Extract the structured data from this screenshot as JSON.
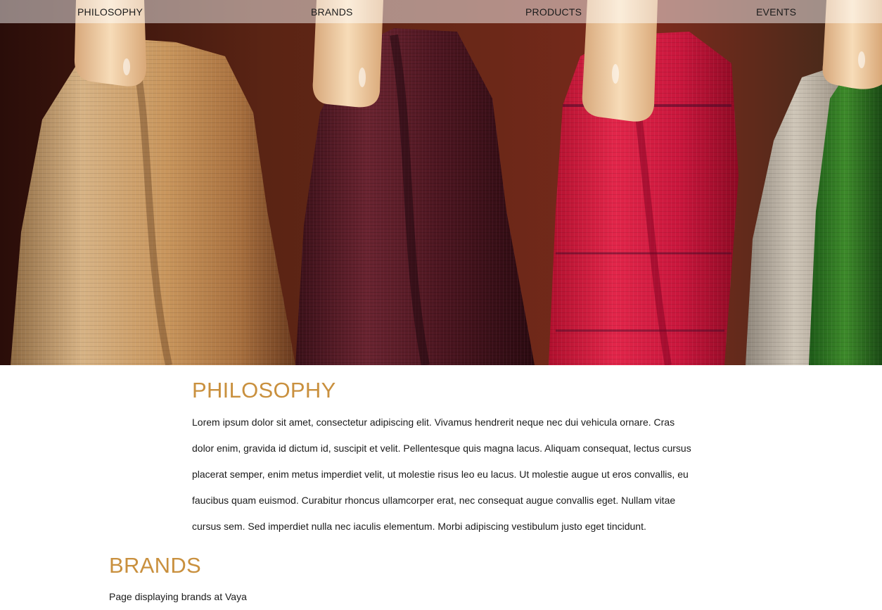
{
  "nav": {
    "items": [
      {
        "label": "PHILOSOPHY"
      },
      {
        "label": "BRANDS"
      },
      {
        "label": "PRODUCTS"
      },
      {
        "label": "EVENTS"
      }
    ]
  },
  "hero": {
    "image": "hero-image"
  },
  "philosophy": {
    "title": "PHILOSOPHY",
    "paragraph": "Lorem ipsum dolor sit amet, consectetur adipiscing elit. Vivamus hendrerit neque nec dui vehicula ornare. Cras dolor enim, gravida id dictum id, suscipit et velit. Pellentesque quis magna lacus. Aliquam consequat, lectus cursus placerat semper, enim metus imperdiet velit, ut molestie risus leo eu lacus. Ut molestie augue ut eros convallis, eu faucibus quam euismod. Curabitur rhoncus ullamcorper erat, nec consequat augue convallis eget. Nullam vitae cursus sem. Sed imperdiet nulla nec iaculis elementum. Morbi adipiscing vestibulum justo eget tincidunt."
  },
  "brands": {
    "title": "BRANDS",
    "description": "Page displaying brands at Vaya"
  },
  "colors": {
    "heading": "#c9903e",
    "text": "#1a1a1a",
    "nav_bg": "rgba(255,255,255,0.48)"
  }
}
